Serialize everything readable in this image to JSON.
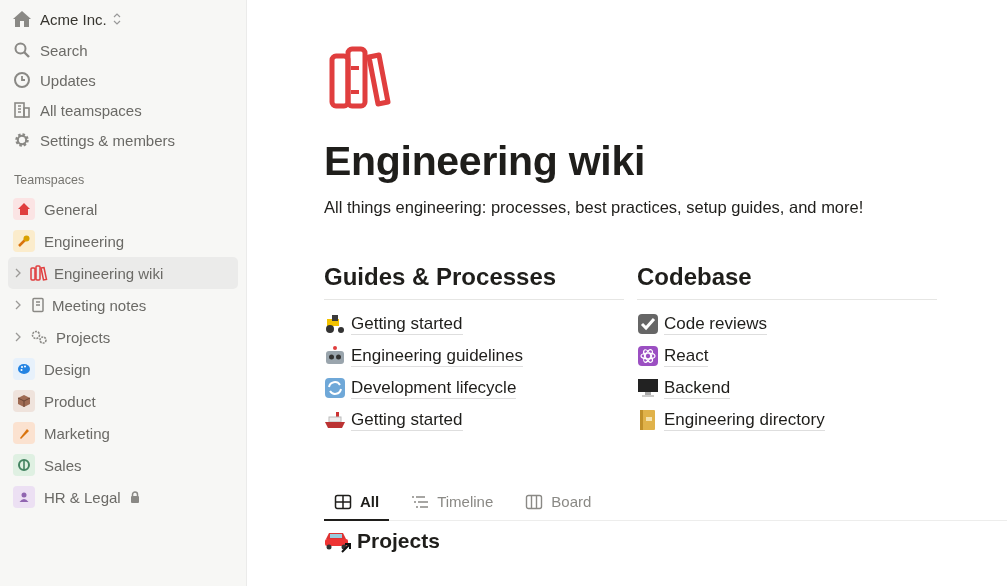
{
  "workspace": {
    "name": "Acme Inc."
  },
  "nav": [
    {
      "label": "Search"
    },
    {
      "label": "Updates"
    },
    {
      "label": "All teamspaces"
    },
    {
      "label": "Settings & members"
    }
  ],
  "teamspaces_heading": "Teamspaces",
  "teamspaces": [
    {
      "label": "General",
      "color": "#fbe4e4",
      "selected": false,
      "locked": false
    },
    {
      "label": "Engineering",
      "color": "#fbeccc",
      "selected": false,
      "locked": false,
      "children": [
        {
          "label": "Engineering wiki",
          "selected": true,
          "expanded": false
        },
        {
          "label": "Meeting notes",
          "selected": false,
          "expanded": false
        },
        {
          "label": "Projects",
          "selected": false,
          "expanded": false
        }
      ]
    },
    {
      "label": "Design",
      "color": "#e7f1fb",
      "selected": false,
      "locked": false
    },
    {
      "label": "Product",
      "color": "#efe3dc",
      "selected": false,
      "locked": false
    },
    {
      "label": "Marketing",
      "color": "#fbe2d0",
      "selected": false,
      "locked": false
    },
    {
      "label": "Sales",
      "color": "#dff0e2",
      "selected": false,
      "locked": false
    },
    {
      "label": "HR & Legal",
      "color": "#ece0f3",
      "selected": false,
      "locked": true
    }
  ],
  "page": {
    "title": "Engineering wiki",
    "description": "All things engineering: processes, best practices, setup guides, and more!"
  },
  "sections": [
    {
      "heading": "Guides & Processes",
      "links": [
        "Getting started",
        "Engineering guidelines",
        "Development lifecycle",
        "Getting started"
      ]
    },
    {
      "heading": "Codebase",
      "links": [
        "Code reviews",
        "React",
        "Backend",
        "Engineering directory"
      ]
    }
  ],
  "tabs": [
    {
      "label": "All",
      "selected": true
    },
    {
      "label": "Timeline",
      "selected": false
    },
    {
      "label": "Board",
      "selected": false
    }
  ],
  "database": {
    "title": "Projects"
  }
}
